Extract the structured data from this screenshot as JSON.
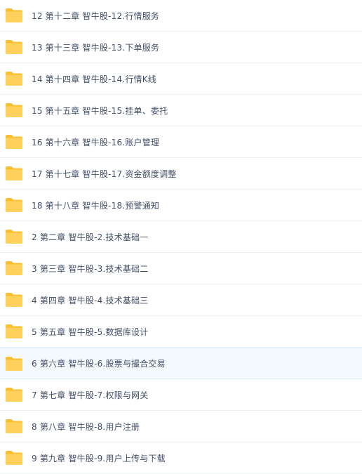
{
  "colors": {
    "folder_body": "#ffd15c",
    "folder_tab": "#f8c031",
    "text": "#424e67",
    "row_border": "#eef1f5",
    "hover_bg": "#f3f9fd"
  },
  "folders": [
    {
      "label": "12 第十二章 智牛股-12.行情服务",
      "icon": "folder-icon"
    },
    {
      "label": "13 第十三章 智牛股-13.下单服务",
      "icon": "folder-icon"
    },
    {
      "label": "14 第十四章 智牛股-14.行情K线",
      "icon": "folder-icon"
    },
    {
      "label": "15 第十五章 智牛股-15.挂单、委托",
      "icon": "folder-icon"
    },
    {
      "label": "16 第十六章 智牛股-16.账户管理",
      "icon": "folder-icon"
    },
    {
      "label": "17 第十七章 智牛股-17.资金额度调整",
      "icon": "folder-icon"
    },
    {
      "label": "18 第十八章 智牛股-18.预警通知",
      "icon": "folder-icon"
    },
    {
      "label": "2 第二章 智牛股-2.技术基础一",
      "icon": "folder-icon"
    },
    {
      "label": "3 第三章 智牛股-3.技术基础二",
      "icon": "folder-icon"
    },
    {
      "label": "4 第四章 智牛股-4.技术基础三",
      "icon": "folder-icon"
    },
    {
      "label": "5 第五章 智牛股-5.数据库设计",
      "icon": "folder-icon"
    },
    {
      "label": "6 第六章 智牛股-6.股票与撮合交易",
      "icon": "folder-icon"
    },
    {
      "label": "7 第七章 智牛股-7.权限与网关",
      "icon": "folder-icon"
    },
    {
      "label": "8 第八章 智牛股-8.用户注册",
      "icon": "folder-icon"
    },
    {
      "label": "9 第九章 智牛股-9.用户上传与下载",
      "icon": "folder-icon"
    }
  ]
}
